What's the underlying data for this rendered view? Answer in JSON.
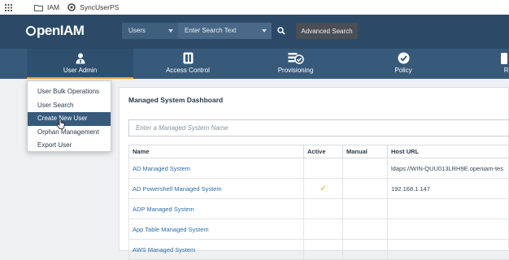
{
  "bookmarks": {
    "items": [
      {
        "label": "IAM",
        "icon": "folder-icon"
      },
      {
        "label": "SyncUserPS",
        "icon": "site-icon"
      }
    ]
  },
  "header": {
    "logo": "penIAM",
    "search_type": "Users",
    "search_placeholder": "Enter Search Text",
    "advanced_search": "Advanced Search"
  },
  "nav": {
    "items": [
      {
        "label": "User Admin",
        "icon": "user-icon",
        "active": true
      },
      {
        "label": "Access Control",
        "icon": "access-card-icon"
      },
      {
        "label": "Provisioning",
        "icon": "provisioning-icon"
      },
      {
        "label": "Policy",
        "icon": "policy-check-icon"
      },
      {
        "label": "Re",
        "icon": "reports-icon"
      }
    ]
  },
  "user_admin_menu": {
    "items": [
      "User Bulk Operations",
      "User Search",
      "Create New User",
      "Orphan Management",
      "Export User"
    ],
    "highlighted": "Create New User"
  },
  "dashboard": {
    "title": "Managed System Dashboard",
    "filter_placeholder": "Enter a Managed System Name",
    "columns": [
      "Name",
      "Active",
      "Manual",
      "Host URL"
    ],
    "rows": [
      {
        "name": "AD Managed System",
        "active": "",
        "manual": "",
        "host": "ldaps://WIN-QUU013LRH9E.openiam-tes"
      },
      {
        "name": "AD Powershell Managed System",
        "active": "✓",
        "manual": "",
        "host": "192.168.1.147"
      },
      {
        "name": "ADP Managed System",
        "active": "",
        "manual": "",
        "host": ""
      },
      {
        "name": "App Table Managed System",
        "active": "",
        "manual": "",
        "host": ""
      },
      {
        "name": "AWS Managed System",
        "active": "",
        "manual": "",
        "host": ""
      }
    ]
  },
  "colors": {
    "topbar": "#2c4a67",
    "nav": "#375a7b",
    "accent": "#f3a02b",
    "link": "#2e6da4"
  }
}
